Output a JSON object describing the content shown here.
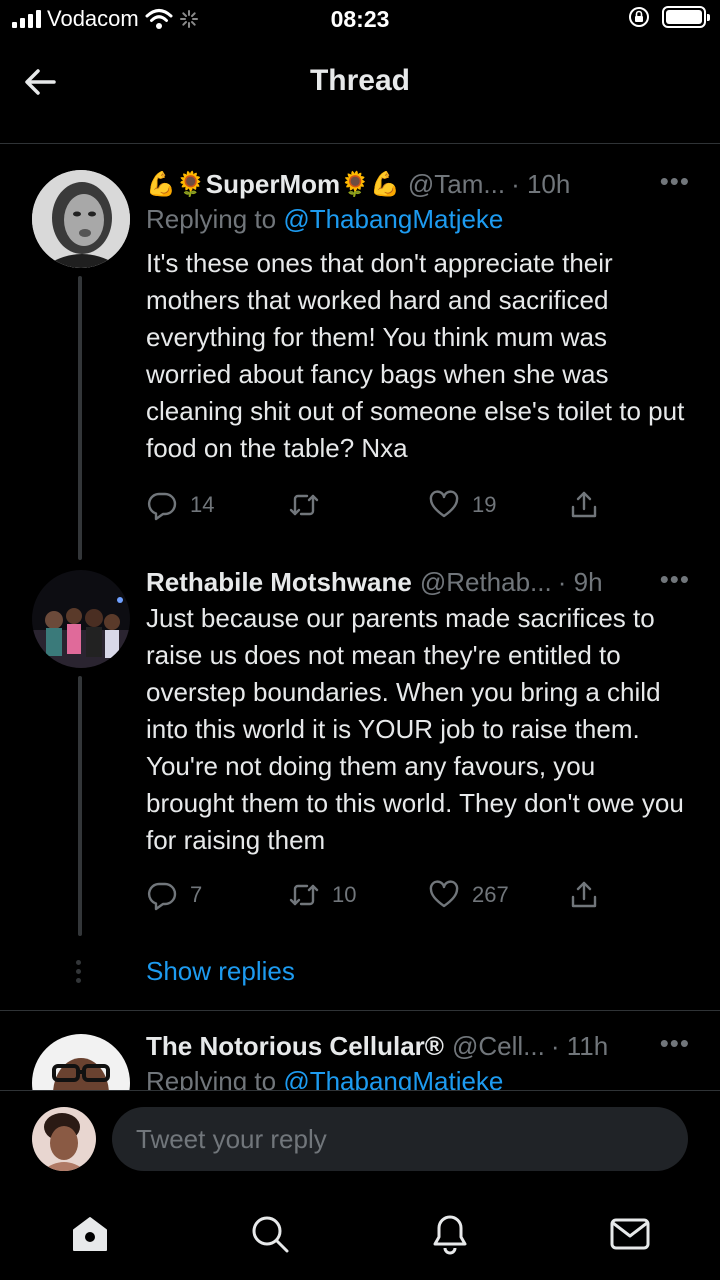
{
  "status_bar": {
    "carrier": "Vodacom",
    "time": "08:23"
  },
  "header": {
    "title": "Thread"
  },
  "tweets": [
    {
      "name_prefix": "💪🌻",
      "name": "SuperMom",
      "name_suffix": "🌻💪",
      "handle": "@Tam...",
      "time": "· 10h",
      "replying_label": "Replying to",
      "replying_to": "@ThabangMatjeke",
      "text": "It's these ones that don't appreciate their mothers that worked hard and sacrificed everything for them! You think mum was worried about fancy bags when she was cleaning shit out of someone else's toilet to put food on the table? Nxa",
      "replies": "14",
      "retweets": "",
      "likes": "19"
    },
    {
      "name": "Rethabile Motshwane",
      "handle": "@Rethab...",
      "time": "· 9h",
      "text": "Just because our parents made sacrifices to raise us does not mean they're entitled to overstep boundaries. When you bring a child into this world it is YOUR job to raise them. You're not doing them any favours, you brought them to this world. They don't owe you for raising them",
      "replies": "7",
      "retweets": "10",
      "likes": "267"
    },
    {
      "name": "The Notorious Cellular®",
      "handle": "@Cell...",
      "time": "· 11h",
      "replying_label": "Replying to",
      "replying_to": "@ThabangMatjeke"
    }
  ],
  "show_replies": "Show replies",
  "more_label": "•••",
  "composer": {
    "placeholder": "Tweet your reply"
  },
  "colors": {
    "background": "#000000",
    "accent": "#1d9bf0",
    "muted": "#71767b",
    "text": "#e7e9ea"
  },
  "icons": {
    "status": [
      "signal-icon",
      "wifi-icon",
      "loading-icon",
      "orientation-lock-icon",
      "battery-icon"
    ],
    "tweet_actions": [
      "reply-icon",
      "retweet-icon",
      "like-icon",
      "share-icon"
    ],
    "tabs": [
      "home-icon",
      "search-icon",
      "notifications-icon",
      "messages-icon"
    ]
  }
}
